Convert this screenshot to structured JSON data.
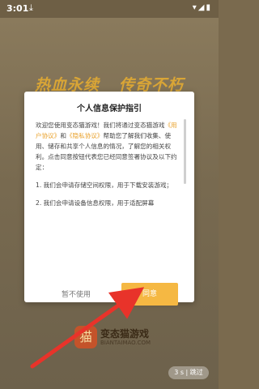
{
  "status_bar": {
    "time": "3:01",
    "download_icon": "download-icon",
    "status_icons": [
      "wifi-icon",
      "signal-icon",
      "battery-icon"
    ]
  },
  "splash": {
    "slogan_left": "热血永续",
    "slogan_right": "传奇不朽",
    "logo_title": "变态猫游戏",
    "logo_sub": "BIANTAIMAO.COM",
    "skip_label": "3 s | 跳过"
  },
  "dialog": {
    "title": "个人信息保护指引",
    "p1_a": "欢迎您使用变态猫游戏！我们将通过变态猫游戏",
    "link_user": "《用户协议》",
    "p1_b": "和",
    "link_privacy": "《隐私协议》",
    "p1_c": "帮助您了解我们收集、使用、储存和共享个人信息的情况，了解您的相关权利。点击同意按钮代表您已经同意签署协议及以下约定：",
    "item1": "1. 我们会申请存储空间权限，用于下载安装游戏；",
    "item2": "2. 我们会申请设备信息权限，用于适配屏幕",
    "decline_label": "暂不使用",
    "agree_label": "同意"
  },
  "colors": {
    "accent": "#f5b843",
    "link": "#e9a12a",
    "annotation_arrow": "#e8332a"
  }
}
